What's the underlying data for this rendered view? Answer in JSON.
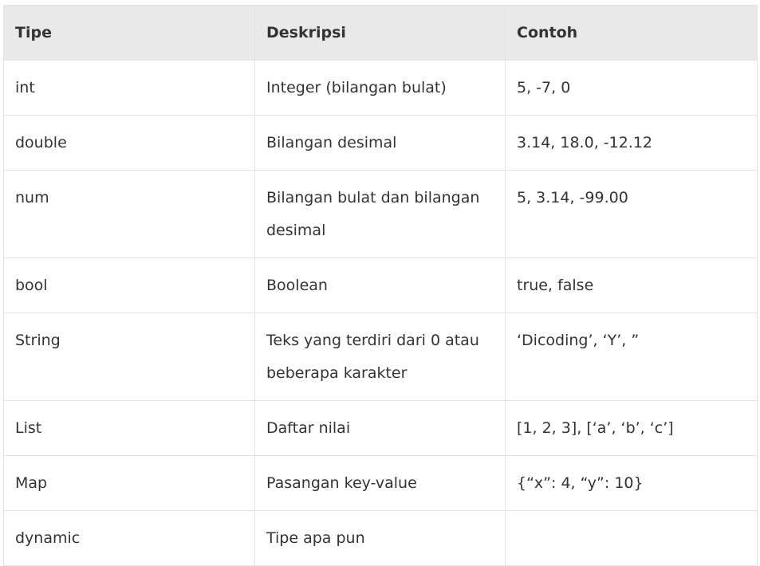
{
  "table": {
    "headers": {
      "type": "Tipe",
      "description": "Deskripsi",
      "example": "Contoh"
    },
    "rows": [
      {
        "type": "int",
        "description": "Integer (bilangan bulat)",
        "example": "5, -7, 0"
      },
      {
        "type": "double",
        "description": "Bilangan desimal",
        "example": "3.14, 18.0, -12.12"
      },
      {
        "type": "num",
        "description": "Bilangan bulat dan bilangan desimal",
        "example": "5, 3.14, -99.00"
      },
      {
        "type": "bool",
        "description": "Boolean",
        "example": "true, false"
      },
      {
        "type": "String",
        "description": "Teks yang terdiri dari 0 atau beberapa karakter",
        "example": "‘Dicoding’, ‘Y’, ”"
      },
      {
        "type": "List",
        "description": "Daftar nilai",
        "example": "[1, 2, 3], [‘a’, ‘b’, ‘c’]"
      },
      {
        "type": "Map",
        "description": "Pasangan key-value",
        "example": "{“x”: 4, “y”: 10}"
      },
      {
        "type": "dynamic",
        "description": "Tipe apa pun",
        "example": ""
      }
    ]
  }
}
